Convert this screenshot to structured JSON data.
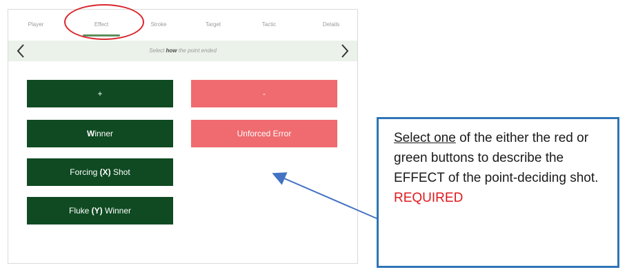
{
  "tabs": [
    {
      "label": "Player"
    },
    {
      "label": "Effect"
    },
    {
      "label": "Stroke"
    },
    {
      "label": "Target"
    },
    {
      "label": "Tactic"
    },
    {
      "label": "Details"
    }
  ],
  "active_tab": "Effect",
  "subheader": {
    "prefix": "Select ",
    "emphasis": "how",
    "suffix": " the point ended"
  },
  "buttons": {
    "plus": "+",
    "minus": "-",
    "winner": {
      "bold": "W",
      "rest": "inner"
    },
    "unforced_error": "Unforced Error",
    "forcing_shot": {
      "pre": "Forcing ",
      "bold": "(X)",
      "post": " Shot"
    },
    "fluke_winner": {
      "pre": "Fluke ",
      "bold": "(Y)",
      "post": " Winner"
    }
  },
  "callout": {
    "underlined": "Select one",
    "text": " of the either the red or green buttons to describe the EFFECT of the point-deciding shot.",
    "required": "REQUIRED"
  },
  "colors": {
    "green_button": "#0f4a22",
    "red_button": "#ef6b6f",
    "subheader_bg": "#eaf2e9",
    "highlight_red": "#d9262b",
    "callout_border": "#2e74b5",
    "required_text": "#e0181c"
  }
}
